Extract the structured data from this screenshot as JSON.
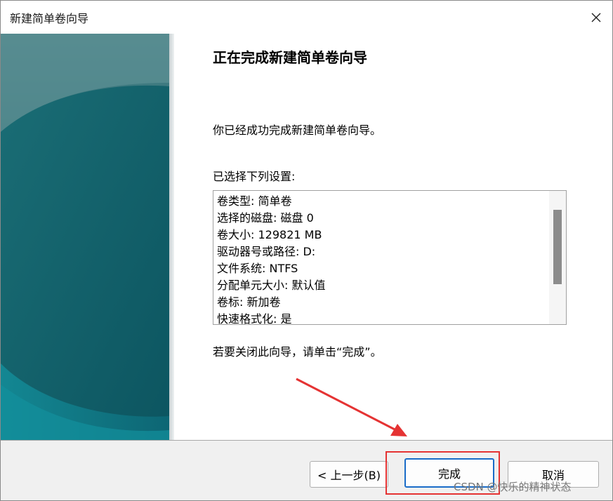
{
  "window": {
    "title": "新建简单卷向导"
  },
  "content": {
    "heading": "正在完成新建简单卷向导",
    "description": "你已经成功完成新建简单卷向导。",
    "settings_label": "已选择下列设置:",
    "settings": [
      "卷类型: 简单卷",
      "选择的磁盘: 磁盘 0",
      "卷大小: 129821 MB",
      "驱动器号或路径: D:",
      "文件系统: NTFS",
      "分配单元大小: 默认值",
      "卷标: 新加卷",
      "快速格式化: 是"
    ],
    "finish_hint": "若要关闭此向导，请单击“完成”。"
  },
  "buttons": {
    "back": "< 上一步(B)",
    "finish": "完成",
    "cancel": "取消"
  },
  "watermark": "CSDN @快乐的精神状态",
  "colors": {
    "sidebar_teal": "#0e5b66",
    "annotation_red": "#e53333",
    "focus_blue": "#1a6cc8"
  },
  "icons": {
    "close": "close-icon"
  }
}
